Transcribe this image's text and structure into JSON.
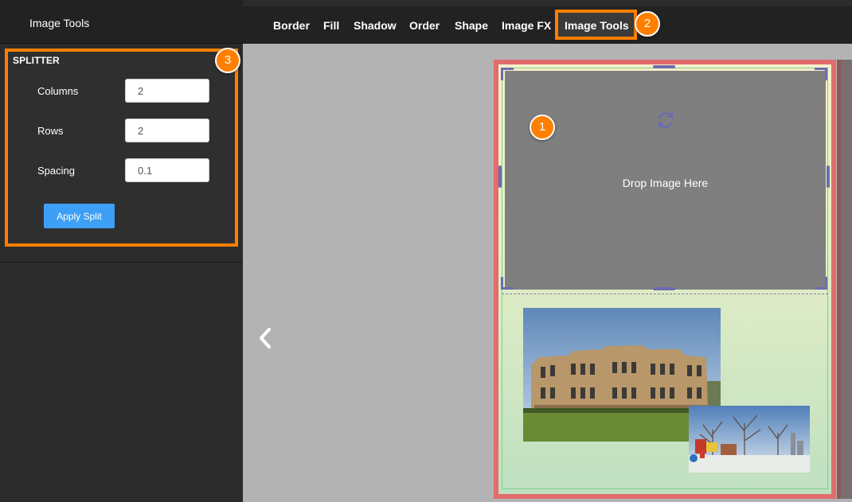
{
  "sidebar": {
    "title": "Image Tools",
    "splitter": {
      "title": "SPLITTER",
      "fields": [
        {
          "label": "Columns",
          "value": "2"
        },
        {
          "label": "Rows",
          "value": "2"
        },
        {
          "label": "Spacing",
          "value": "0.1"
        }
      ],
      "apply_label": "Apply Split"
    }
  },
  "menu": {
    "items": [
      "Border",
      "Fill",
      "Shadow",
      "Order",
      "Shape",
      "Image FX",
      "Image Tools"
    ],
    "active": "Image Tools"
  },
  "badges": [
    "1",
    "2",
    "3"
  ],
  "canvas": {
    "drop_text": "Drop Image Here",
    "icons": [
      "chevron-left-icon",
      "refresh-icon"
    ]
  },
  "colors": {
    "accent": "#ff7f00",
    "button": "#3d9ff5",
    "page_border": "#e06c6c",
    "handles": "#6c6cb0"
  }
}
